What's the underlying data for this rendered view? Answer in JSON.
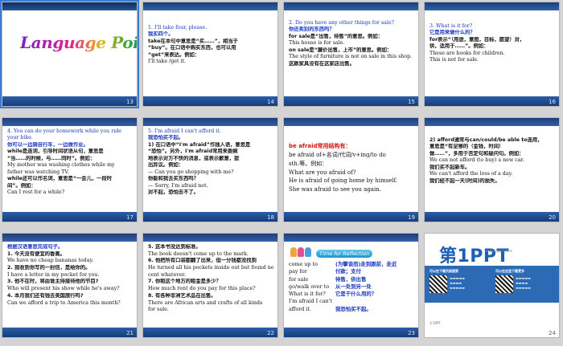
{
  "slides": [
    {
      "number": "13",
      "title_art": "Language Points"
    },
    {
      "number": "14",
      "lines": [
        "1. I'll take four, please.",
        "我买四个。",
        "take在本句中意思是“买……”，相当于",
        "“buy”。在口语中购买东西，也可以用",
        "“get”来表达。例如：",
        "I'll take /get it."
      ]
    },
    {
      "number": "15",
      "lines": [
        "2. Do you have any other things for sale?",
        "你还卖别的东西吗？",
        "for sale是“出售，待售”的意思。例如：",
        "This house is for sale.",
        "on sale是“廉价出售，上市”的意思。例如：",
        "The style of furniture is not on sale in this shop.",
        "这款家具没有在这家店出售。"
      ]
    },
    {
      "number": "16",
      "lines": [
        "3. What is it for?",
        "它是用来做什么的？",
        "for表示“（用途，意图，目标，愿望）对，",
        "供，适用于……”。例如：",
        "These are books for children.",
        "This is not for sale."
      ]
    },
    {
      "number": "17",
      "lines": [
        "4. You can do your homework while you ride",
        "your bike.",
        "你可以一边骑自行车，一边做作业。",
        "while是连词，引导时间状语从句，意思是",
        "“当……的时候，与……同时”。例如：",
        "My mother was washing clothes while my",
        "father was watching TV.",
        "while还可以作名词，意思是“一会儿，一段时",
        "间”。例如：",
        "Can I rest for a while?"
      ]
    },
    {
      "number": "18",
      "lines": [
        "5. I'm afraid I can't afford it.",
        "我恐怕买不起。",
        "1) 在口语中“I'm afraid”作插入语，意思是",
        "“恐怕”。另外，I'm afraid常用来委婉",
        "地表示对方不快的消息，或表示歉意，提",
        "出异议。例如：",
        "— Can you go shopping with me?",
        "你能和我去买东西吗？",
        "— Sorry, I'm afraid not.",
        "对不起，恐怕去不了。"
      ]
    },
    {
      "number": "19",
      "lines": [
        "be afraid常用结构有：",
        "be afraid of+名词/代词/v+ing/to do",
        "sth.等。例如：",
        "What are you afraid of?",
        "He is afraid of going home by himself.",
        "She was afraid to see you again."
      ]
    },
    {
      "number": "20",
      "lines": [
        "2) afford通常与can/could/be able to连用，",
        "意思是“有足够的（金钱，时间）",
        "做……”，多用于否定句和疑问句。例如：",
        "We can not afford (to buy) a new car.",
        "我们买不起新车。",
        "We can't afford the loss of a day.",
        "我们经不起一天(时间)的损失。"
      ]
    },
    {
      "number": "21",
      "lines": [
        "根据汉语意思完成句子。",
        "1. 今天没有便宜的香蕉。",
        "We have no cheap bananas today.",
        "2. 我收到你写的一封信，是给你的。",
        "I have a letter in my pocket for you.",
        "3. 他不在时，将由谁主持接待他的节目?",
        "Who will present his show while he's away?",
        "4. 本月我们还有钱去美国旅行吗?",
        "Can we afford a trip to America this month?"
      ],
      "blanks": [
        "cheap",
        "pocket",
        "while",
        "afford"
      ]
    },
    {
      "number": "22",
      "lines": [
        "5. 这本书没达到标准。",
        "The book doesn't come up to the mark.",
        "6. 他把所有口袋都翻了出来，但一分钱都没找到",
        "He turned all his pockets inside out but found no",
        "cent whatever.",
        "7. 你租这个地方的租金是多少？",
        "How much rent do you pay for this place?",
        "8. 有各种非洲艺术品在出售。",
        "There are African arts and crafts of all kinds",
        "for sale."
      ],
      "blanks": [
        "come up to",
        "cent",
        "pay for",
        "for sale"
      ]
    },
    {
      "number": "23",
      "header": "Time for Reflection",
      "pairs": [
        [
          "come up to",
          "(为攀谈而)走到跟前，走近"
        ],
        [
          "pay for",
          "付款；支付"
        ],
        [
          "for sale",
          "待售，供出售"
        ],
        [
          "go/walk over to",
          "从一处到另一处"
        ],
        [
          "What is it for?",
          "它是干什么用的？"
        ],
        [
          "I'm afraid I can't afford it.",
          "我恐怕买不起。"
        ]
      ]
    },
    {
      "number": "24",
      "logo": "第1PPT",
      "logo_sub": "www.1ppt.com",
      "qr_title_left": "可以在下载页面搜索",
      "qr_title_right": "可以在这里下载更多",
      "footnote": "©1PPT"
    }
  ],
  "selected_slide": "13",
  "colors": {
    "accent": "#2c5ea8",
    "pink": "#e0219a",
    "blue": "#1a37c0",
    "red": "#d11515"
  }
}
